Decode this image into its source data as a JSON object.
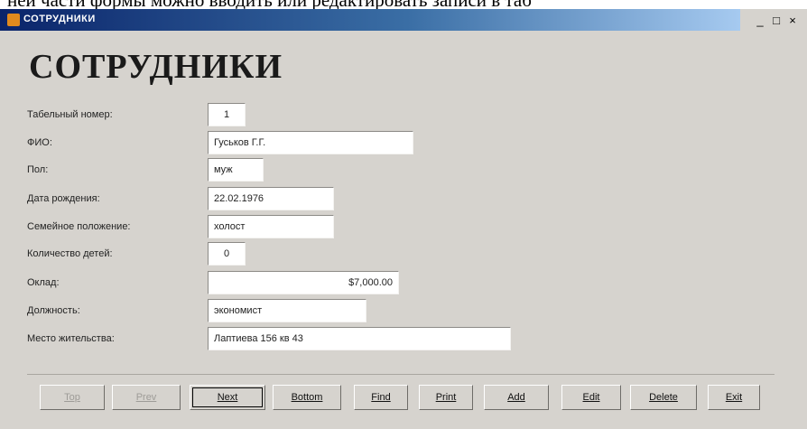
{
  "document_line": "ней части формы можно вводить или редактировать записи в таб",
  "window": {
    "title": "СОТРУДНИКИ",
    "controls": {
      "minimize": "_",
      "maximize": "□",
      "close": "×"
    }
  },
  "form": {
    "heading": "СОТРУДНИКИ",
    "fields": [
      {
        "label": "Табельный номер:",
        "value": "1"
      },
      {
        "label": "ФИО:",
        "value": "Гуськов Г.Г."
      },
      {
        "label": "Пол:",
        "value": "муж"
      },
      {
        "label": "Дата рождения:",
        "value": "22.02.1976"
      },
      {
        "label": "Семейное положение:",
        "value": "холост"
      },
      {
        "label": "Количество детей:",
        "value": "0"
      },
      {
        "label": "Оклад:",
        "value": "$7,000.00"
      },
      {
        "label": "Должность:",
        "value": "экономист"
      },
      {
        "label": "Место жительства:",
        "value": "Лаптиева 156 кв 43"
      }
    ]
  },
  "buttons": [
    {
      "label": "Top",
      "enabled": false
    },
    {
      "label": "Prev",
      "enabled": false
    },
    {
      "label": "Next",
      "enabled": true
    },
    {
      "label": "Bottom",
      "enabled": true
    },
    {
      "label": "Find",
      "enabled": true
    },
    {
      "label": "Print",
      "enabled": true
    },
    {
      "label": "Add",
      "enabled": true
    },
    {
      "label": "Edit",
      "enabled": true
    },
    {
      "label": "Delete",
      "enabled": true
    },
    {
      "label": "Exit",
      "enabled": true
    }
  ]
}
